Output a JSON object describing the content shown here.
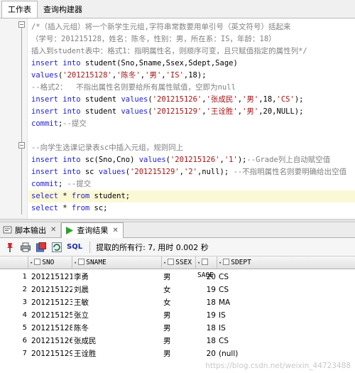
{
  "top_tabs": [
    {
      "label": "工作表",
      "active": true
    },
    {
      "label": "查询构建器",
      "active": false
    }
  ],
  "code_lines": [
    {
      "segments": [
        {
          "t": "/*（插入元组）将一个新学生元组,字符串常数要用单引号（英文符号）括起来",
          "c": "cm"
        }
      ]
    },
    {
      "segments": [
        {
          "t": "（学号：201215128，姓名：陈冬，性别：男，所在系：IS，年龄：18）",
          "c": "cm"
        }
      ]
    },
    {
      "segments": [
        {
          "t": "插入到student表中：格式1：指明属性名，则顺序可变，且只赋值指定的属性列*/",
          "c": "cm"
        }
      ]
    },
    {
      "segments": [
        {
          "t": "insert into ",
          "c": "kw"
        },
        {
          "t": "student(Sno,Sname,Ssex,Sdept,Sage)",
          "c": "nm"
        }
      ]
    },
    {
      "segments": [
        {
          "t": "values",
          "c": "kw"
        },
        {
          "t": "(",
          "c": "nm"
        },
        {
          "t": "'201215128'",
          "c": "st"
        },
        {
          "t": ",",
          "c": "nm"
        },
        {
          "t": "'陈冬'",
          "c": "st"
        },
        {
          "t": ",",
          "c": "nm"
        },
        {
          "t": "'男'",
          "c": "st"
        },
        {
          "t": ",",
          "c": "nm"
        },
        {
          "t": "'IS'",
          "c": "st"
        },
        {
          "t": ",18);",
          "c": "nm"
        }
      ]
    },
    {
      "segments": [
        {
          "t": "--格式2：  不指出属性名则要给所有属性赋值，空即为null",
          "c": "cm"
        }
      ]
    },
    {
      "segments": [
        {
          "t": "insert into ",
          "c": "kw"
        },
        {
          "t": "student ",
          "c": "nm"
        },
        {
          "t": "values",
          "c": "kw"
        },
        {
          "t": "(",
          "c": "nm"
        },
        {
          "t": "'201215126'",
          "c": "st"
        },
        {
          "t": ",",
          "c": "nm"
        },
        {
          "t": "'张成民'",
          "c": "st"
        },
        {
          "t": ",",
          "c": "nm"
        },
        {
          "t": "'男'",
          "c": "st"
        },
        {
          "t": ",18,",
          "c": "nm"
        },
        {
          "t": "'CS'",
          "c": "st"
        },
        {
          "t": ");",
          "c": "nm"
        }
      ]
    },
    {
      "segments": [
        {
          "t": "insert into ",
          "c": "kw"
        },
        {
          "t": "student ",
          "c": "nm"
        },
        {
          "t": "values",
          "c": "kw"
        },
        {
          "t": "(",
          "c": "nm"
        },
        {
          "t": "'201215129'",
          "c": "st"
        },
        {
          "t": ",",
          "c": "nm"
        },
        {
          "t": "'王诠胜'",
          "c": "st"
        },
        {
          "t": ",",
          "c": "nm"
        },
        {
          "t": "'男'",
          "c": "st"
        },
        {
          "t": ",20,NULL);",
          "c": "nm"
        }
      ]
    },
    {
      "segments": [
        {
          "t": "commit",
          "c": "kw"
        },
        {
          "t": ";",
          "c": "nm"
        },
        {
          "t": "--提交",
          "c": "cm"
        }
      ]
    },
    {
      "segments": []
    },
    {
      "segments": [
        {
          "t": "--向学生选课记录表sc中插入元组，规则同上",
          "c": "cm"
        }
      ]
    },
    {
      "segments": [
        {
          "t": "insert into ",
          "c": "kw"
        },
        {
          "t": "sc(Sno,Cno) ",
          "c": "nm"
        },
        {
          "t": "values",
          "c": "kw"
        },
        {
          "t": "(",
          "c": "nm"
        },
        {
          "t": "'201215126'",
          "c": "st"
        },
        {
          "t": ",",
          "c": "nm"
        },
        {
          "t": "'1'",
          "c": "st"
        },
        {
          "t": ");",
          "c": "nm"
        },
        {
          "t": "--Grade列上自动赋空值",
          "c": "cm"
        }
      ]
    },
    {
      "segments": [
        {
          "t": "insert into ",
          "c": "kw"
        },
        {
          "t": "sc ",
          "c": "nm"
        },
        {
          "t": "values",
          "c": "kw"
        },
        {
          "t": "(",
          "c": "nm"
        },
        {
          "t": "'201215129'",
          "c": "st"
        },
        {
          "t": ",",
          "c": "nm"
        },
        {
          "t": "'2'",
          "c": "st"
        },
        {
          "t": ",null); ",
          "c": "nm"
        },
        {
          "t": "--不指明属性名则要明确给出空值",
          "c": "cm"
        }
      ]
    },
    {
      "segments": [
        {
          "t": "commit",
          "c": "kw"
        },
        {
          "t": "; ",
          "c": "nm"
        },
        {
          "t": "--提交",
          "c": "cm"
        }
      ]
    },
    {
      "segments": [
        {
          "t": "select ",
          "c": "kw"
        },
        {
          "t": "* ",
          "c": "nm"
        },
        {
          "t": "from ",
          "c": "kw"
        },
        {
          "t": "student;",
          "c": "nm"
        }
      ],
      "highlight": true
    },
    {
      "segments": [
        {
          "t": "select ",
          "c": "kw"
        },
        {
          "t": "* ",
          "c": "nm"
        },
        {
          "t": "from ",
          "c": "kw"
        },
        {
          "t": "sc;",
          "c": "nm"
        }
      ]
    }
  ],
  "bottom_tabs": [
    {
      "label": "脚本输出",
      "icon": "script-output-icon",
      "active": false
    },
    {
      "label": "查询结果",
      "icon": "query-result-icon",
      "active": true
    }
  ],
  "toolbar": {
    "sql_label": "SQL",
    "status_text": "提取的所有行: 7, 用时 0.002 秒"
  },
  "grid": {
    "columns": [
      "SNO",
      "SNAME",
      "SSEX",
      "SAGE",
      "SDEPT"
    ],
    "rows": [
      {
        "n": "1",
        "sno": "201215121",
        "sname": "李勇",
        "ssex": "男",
        "sage": "20",
        "sdept": "CS"
      },
      {
        "n": "2",
        "sno": "201215122",
        "sname": "刘晨",
        "ssex": "女",
        "sage": "19",
        "sdept": "CS"
      },
      {
        "n": "3",
        "sno": "201215123",
        "sname": "王敏",
        "ssex": "女",
        "sage": "18",
        "sdept": "MA"
      },
      {
        "n": "4",
        "sno": "201215125",
        "sname": "张立",
        "ssex": "男",
        "sage": "19",
        "sdept": "IS"
      },
      {
        "n": "5",
        "sno": "201215128",
        "sname": "陈冬",
        "ssex": "男",
        "sage": "18",
        "sdept": "IS"
      },
      {
        "n": "6",
        "sno": "201215126",
        "sname": "张成民",
        "ssex": "男",
        "sage": "18",
        "sdept": "CS"
      },
      {
        "n": "7",
        "sno": "201215129",
        "sname": "王诠胜",
        "ssex": "男",
        "sage": "20",
        "sdept": "(null)"
      }
    ]
  },
  "watermark": "https://blog.csdn.net/weixin_44723488",
  "colors": {
    "keyword": "#2222cc",
    "string": "#a31515",
    "comment": "#808080",
    "highlight": "#fbf8d6"
  }
}
